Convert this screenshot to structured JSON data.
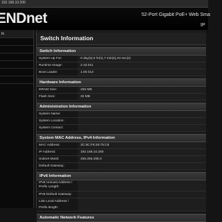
{
  "topbar": {
    "url": "192.168.10.200"
  },
  "header": {
    "logo": "ENDnet",
    "product_line1": "52-Port Gigabit PoE+ Web Sma",
    "product_line2": "IP"
  },
  "sidebar": {
    "items": [
      {
        "label": "fo"
      },
      {
        "label": ""
      },
      {
        "label": ""
      },
      {
        "label": ""
      },
      {
        "label": ""
      },
      {
        "label": ""
      },
      {
        "label": ""
      }
    ]
  },
  "main": {
    "title": "Switch Information",
    "sections": [
      {
        "title": "Switch Information",
        "rows": [
          {
            "label": "System Up For:",
            "value": "0 day(s),0 hr(s),7 min(s),23 sec(s)"
          },
          {
            "label": "Runtime Image:",
            "value": "2.10.011"
          },
          {
            "label": "Boot Loader:",
            "value": "1.00.013"
          }
        ]
      },
      {
        "title": "Hardware Information",
        "rows": [
          {
            "label": "DRAM Size:",
            "value": "256 MB"
          },
          {
            "label": "Flash Size:",
            "value": "32 MB"
          }
        ]
      },
      {
        "title": "Administration Information",
        "rows": [
          {
            "label": "System Name:",
            "value": ""
          },
          {
            "label": "System Location:",
            "value": ""
          },
          {
            "label": "System Contact:",
            "value": ""
          }
        ]
      },
      {
        "title": "System MAC Address, IPv4 Information",
        "rows": [
          {
            "label": "MAC Address:",
            "value": "3C:8C:F8:26:75:C8"
          },
          {
            "label": "IP Address:",
            "value": "192.168.10.200"
          },
          {
            "label": "Subnet Mask:",
            "value": "255.255.255.0"
          },
          {
            "label": "Default Gateway:",
            "value": ""
          }
        ]
      },
      {
        "title": "IPv6 Information",
        "rows": [
          {
            "label": "IPv6 Unicast Address / Prefix Length:",
            "value": "",
            "tall": true
          },
          {
            "label": "IPv6 Default Gateway:",
            "value": ""
          },
          {
            "label": "Link Local Address / Prefix length:",
            "value": ""
          }
        ]
      },
      {
        "title": "Automatic Network Features",
        "rows": []
      }
    ]
  }
}
